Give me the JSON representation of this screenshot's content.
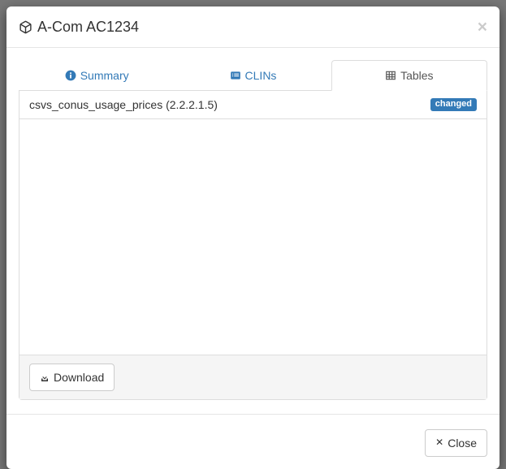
{
  "modal": {
    "title": "A-Com AC1234"
  },
  "tabs": {
    "summary": "Summary",
    "clins": "CLINs",
    "tables": "Tables"
  },
  "table_item": {
    "name": "csvs_conus_usage_prices",
    "version": "(2.2.2.1.5)",
    "status": "changed"
  },
  "buttons": {
    "download": "Download",
    "close": "Close"
  }
}
